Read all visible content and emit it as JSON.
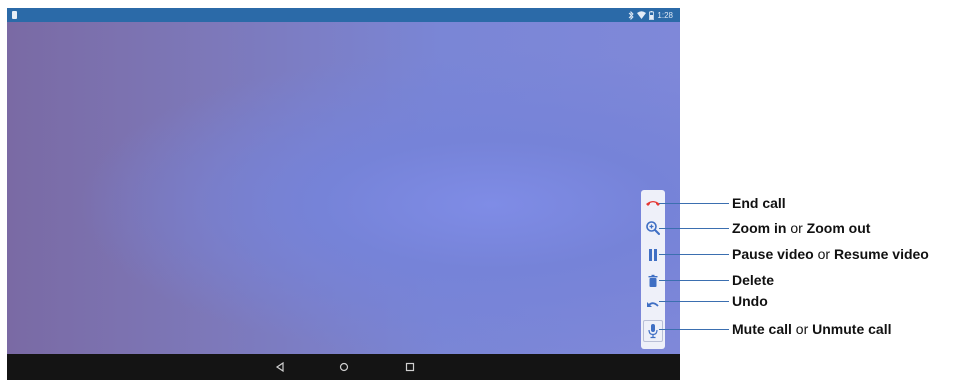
{
  "status_bar": {
    "time": "1:28",
    "icons": [
      "bluetooth-icon",
      "wifi-icon",
      "battery-icon"
    ]
  },
  "toolbar": {
    "buttons": [
      {
        "icon": "end-call-icon",
        "color": "#e53935"
      },
      {
        "icon": "zoom-in-icon",
        "color": "#3f6fc4"
      },
      {
        "icon": "pause-icon",
        "color": "#3f6fc4"
      },
      {
        "icon": "delete-icon",
        "color": "#3f6fc4"
      },
      {
        "icon": "undo-icon",
        "color": "#3f6fc4"
      },
      {
        "icon": "microphone-icon",
        "color": "#3f6fc4"
      }
    ]
  },
  "callouts": {
    "end_call": {
      "bold1": "End call"
    },
    "zoom": {
      "bold1": "Zoom in",
      "connector": " or ",
      "bold2": "Zoom out"
    },
    "pause": {
      "bold1": "Pause video",
      "connector": " or ",
      "bold2": "Resume video"
    },
    "delete": {
      "bold1": "Delete"
    },
    "undo": {
      "bold1": "Undo"
    },
    "mute": {
      "bold1": "Mute call",
      "connector": " or ",
      "bold2": "Unmute call"
    }
  },
  "navigation": {
    "buttons": [
      "back-icon",
      "home-icon",
      "recents-icon"
    ]
  },
  "colors": {
    "status_bar": "#2b6aa8",
    "toolbar_bg": "#eef0f9",
    "accent": "#3f6fc4",
    "end_call": "#e53935",
    "callout_line": "#3b6fb0"
  }
}
